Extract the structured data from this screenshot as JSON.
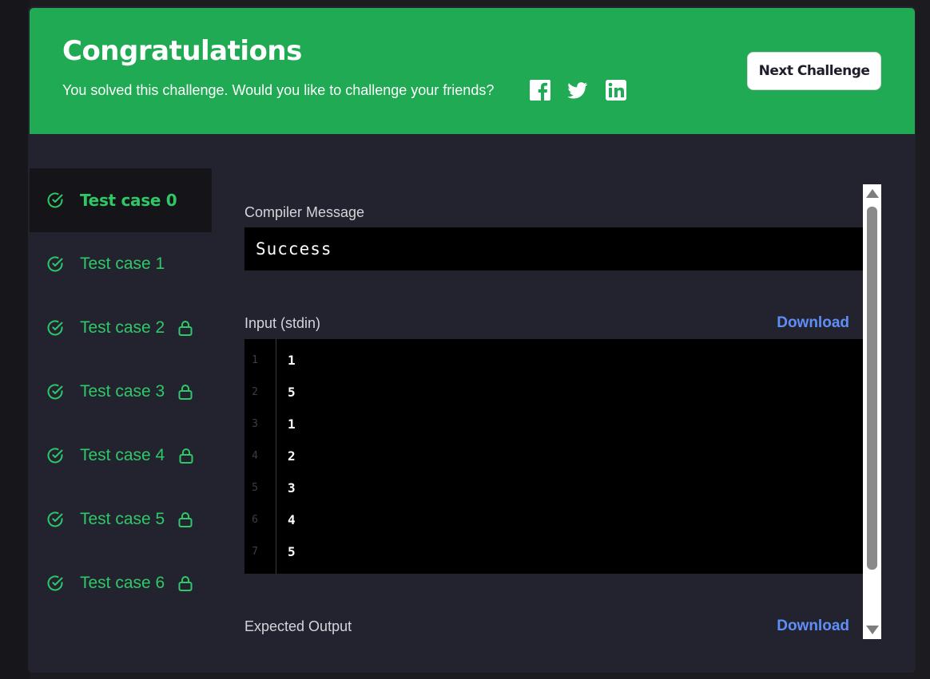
{
  "banner": {
    "title": "Congratulations",
    "subtitle": "You solved this challenge. Would you like to challenge your friends?",
    "social": [
      "facebook-icon",
      "twitter-icon",
      "linkedin-icon"
    ],
    "next_button": "Next Challenge",
    "color": "#1faa53"
  },
  "tabs": [
    {
      "label": "Test case 0",
      "passed": true,
      "locked": false,
      "active": true
    },
    {
      "label": "Test case 1",
      "passed": true,
      "locked": false,
      "active": false
    },
    {
      "label": "Test case 2",
      "passed": true,
      "locked": true,
      "active": false
    },
    {
      "label": "Test case 3",
      "passed": true,
      "locked": true,
      "active": false
    },
    {
      "label": "Test case 4",
      "passed": true,
      "locked": true,
      "active": false
    },
    {
      "label": "Test case 5",
      "passed": true,
      "locked": true,
      "active": false
    },
    {
      "label": "Test case 6",
      "passed": true,
      "locked": true,
      "active": false
    }
  ],
  "compiler": {
    "label": "Compiler Message",
    "message": "Success"
  },
  "input": {
    "label": "Input (stdin)",
    "download": "Download",
    "lines": [
      {
        "num": "1",
        "text": "1"
      },
      {
        "num": "2",
        "text": "5"
      },
      {
        "num": "3",
        "text": "1"
      },
      {
        "num": "4",
        "text": "2"
      },
      {
        "num": "5",
        "text": "3"
      },
      {
        "num": "6",
        "text": "4"
      },
      {
        "num": "7",
        "text": "5"
      }
    ]
  },
  "expected": {
    "label": "Expected Output",
    "download": "Download"
  },
  "colors": {
    "accent_green": "#2ec866",
    "link_blue": "#5f8ff6",
    "panel_bg": "#232330"
  }
}
